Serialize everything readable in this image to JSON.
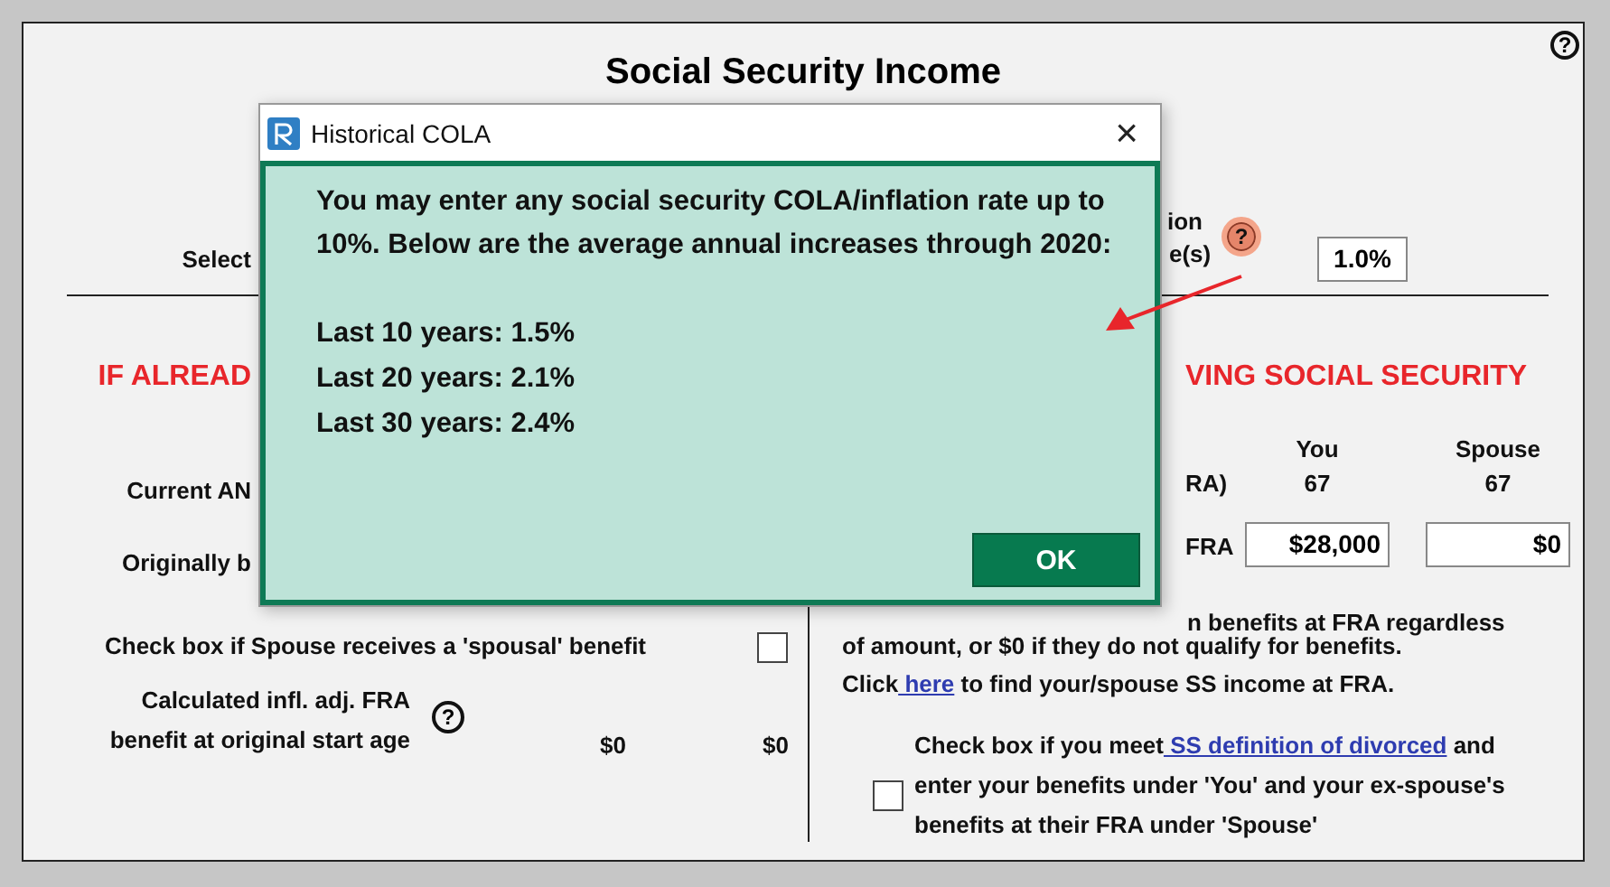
{
  "sheet": {
    "title": "Social Security Income",
    "help": "?",
    "cola": {
      "label_start": "Select",
      "label_end_1": "ion",
      "label_end_2": "e(s)",
      "help": "?",
      "value": "1.0%"
    },
    "left": {
      "heading": "IF ALREAD",
      "current_label": "Current AN",
      "originally_label": "Originally b",
      "spousal": {
        "label": "Check box if Spouse receives a 'spousal' benefit",
        "checked": false
      },
      "calculated": {
        "label": "Calculated infl. adj. FRA benefit at original start age",
        "help": "?",
        "you": "$0",
        "spouse": "$0"
      }
    },
    "right": {
      "heading": "VING SOCIAL SECURITY",
      "columns": [
        "You",
        "Spouse"
      ],
      "fra_label": "RA)",
      "ages": [
        "67",
        "67"
      ],
      "benefit_label": "FRA",
      "benefits": [
        "$28,000",
        "$0"
      ],
      "note": {
        "line_end": "n benefits at FRA regardless",
        "text": "of amount, or $0 if they do not qualify for benefits.",
        "click": "Click",
        "link": " here",
        "after": "to find your/spouse SS income at FRA."
      },
      "divorced": {
        "checked": false,
        "before": "Check box if you meet",
        "link": " SS definition of divorced",
        "after": "and enter your benefits under 'You' and your ex-spouse's benefits at their FRA under 'Spouse'"
      }
    }
  },
  "dialog": {
    "title": "Historical COLA",
    "close": "×",
    "message": "You may enter any social security COLA/inflation rate up to 10%. Below are the average annual increases through 2020:",
    "lines": [
      "Last 10 years: 1.5%",
      "Last 20 years: 2.1%",
      "Last 30 years: 2.4%"
    ],
    "button": "OK"
  }
}
